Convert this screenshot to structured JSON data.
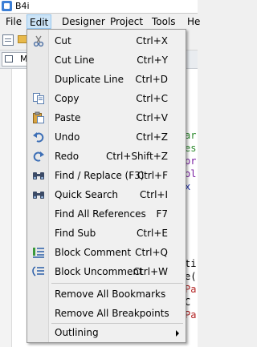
{
  "window": {
    "title": "B4i"
  },
  "menubar": {
    "items": [
      {
        "label": "File"
      },
      {
        "label": "Edit"
      },
      {
        "label": "Designer"
      },
      {
        "label": "Project"
      },
      {
        "label": "Tools"
      },
      {
        "label": "He"
      }
    ]
  },
  "tabs": {
    "module_tab": "M"
  },
  "editor": {
    "code_fragments": [
      "ar",
      "es",
      "pr",
      "ol",
      "x",
      "ti",
      "e(",
      "Pa",
      "C",
      "Pa"
    ]
  },
  "edit_menu": {
    "items": [
      {
        "label": "Cut",
        "shortcut": "Ctrl+X",
        "icon": "scissors-icon"
      },
      {
        "label": "Cut Line",
        "shortcut": "Ctrl+Y"
      },
      {
        "label": "Duplicate Line",
        "shortcut": "Ctrl+D"
      },
      {
        "label": "Copy",
        "shortcut": "Ctrl+C",
        "icon": "copy-icon"
      },
      {
        "label": "Paste",
        "shortcut": "Ctrl+V",
        "icon": "paste-icon"
      },
      {
        "label": "Undo",
        "shortcut": "Ctrl+Z",
        "icon": "undo-icon"
      },
      {
        "label": "Redo",
        "shortcut": "Ctrl+Shift+Z",
        "icon": "redo-icon"
      },
      {
        "label": "Find / Replace (F3)",
        "shortcut": "Ctrl+F",
        "icon": "binoculars-icon"
      },
      {
        "label": "Quick Search",
        "shortcut": "Ctrl+I",
        "icon": "binoculars-icon"
      },
      {
        "label": "Find All References",
        "shortcut": "F7"
      },
      {
        "label": "Find Sub",
        "shortcut": "Ctrl+E"
      },
      {
        "label": "Block Comment",
        "shortcut": "Ctrl+Q",
        "icon": "block-comment-icon"
      },
      {
        "label": "Block Uncomment",
        "shortcut": "Ctrl+W",
        "icon": "block-uncomment-icon"
      },
      {
        "label": "Remove All Bookmarks"
      },
      {
        "label": "Remove All Breakpoints"
      },
      {
        "label": "Outlining"
      }
    ]
  }
}
